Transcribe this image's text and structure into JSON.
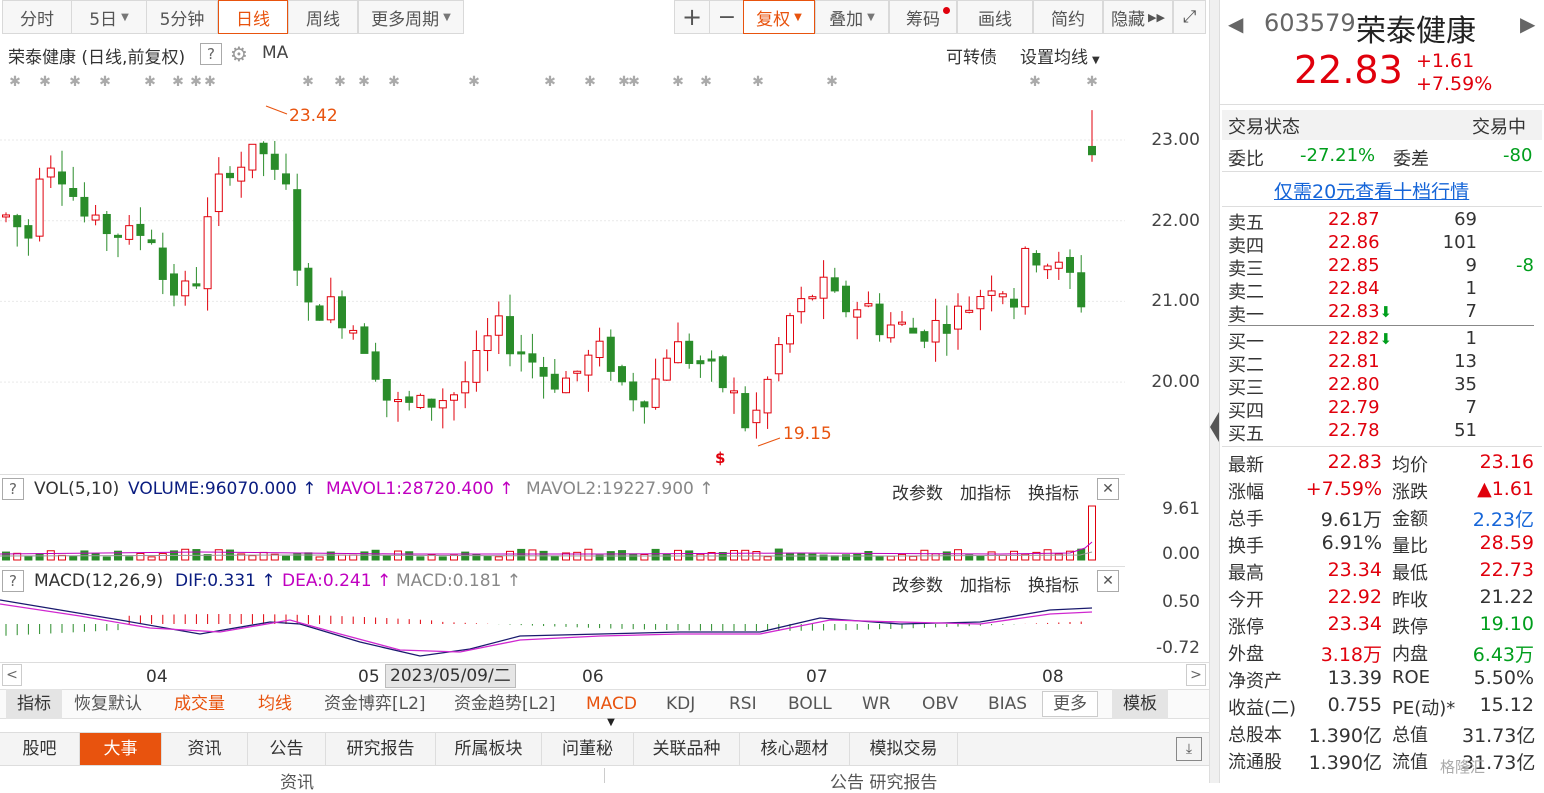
{
  "toolbar": {
    "periods": [
      "分时",
      "5日",
      "5分钟",
      "日线",
      "周线",
      "更多周期"
    ],
    "zoom_in": "+",
    "zoom_out": "−",
    "right": [
      "复权",
      "叠加",
      "筹码",
      "画线",
      "简约",
      "隐藏"
    ],
    "expand": "⤢"
  },
  "chart": {
    "title": "荣泰健康 (日线,前复权)",
    "help": "?",
    "ma": "MA",
    "convertible": "可转债",
    "set_ma": "设置均线",
    "y_labels": [
      "23.00",
      "22.00",
      "21.00",
      "20.00"
    ],
    "high_label": "23.42",
    "low_label": "19.15",
    "s_marker": "$",
    "y_ticks": [
      23,
      22,
      21,
      20
    ],
    "y_range": [
      19.15,
      23.42
    ]
  },
  "vol": {
    "help": "?",
    "name": "VOL(5,10)",
    "volume": "VOLUME:96070.000",
    "mavol1": "MAVOL1:28720.400",
    "mavol2": "MAVOL2:19227.900",
    "arrow": "↑",
    "y_top": "9.61",
    "y_bot": "0.00"
  },
  "macd": {
    "help": "?",
    "name": "MACD(12,26,9)",
    "dif": "DIF:0.331",
    "dea": "DEA:0.241",
    "macd": "MACD:0.181",
    "arrow": "↑",
    "y_top": "0.50",
    "y_bot": "-0.72"
  },
  "indicator_btns": [
    "改参数",
    "加指标",
    "换指标"
  ],
  "close_x": "✕",
  "xaxis": {
    "labels": [
      "04",
      "05",
      "06",
      "07",
      "08"
    ],
    "cursor_date": "2023/05/09/二",
    "left_arrow": "<",
    "right_arrow": ">"
  },
  "indicator_tabs": {
    "first": "指标",
    "items": [
      "恢复默认",
      "成交量",
      "均线",
      "资金博弈[L2]",
      "资金趋势[L2]",
      "MACD",
      "KDJ",
      "RSI",
      "BOLL",
      "WR",
      "OBV",
      "BIAS"
    ],
    "more": "更多",
    "template": "模板"
  },
  "bottom_tabs": [
    "股吧",
    "大事",
    "资讯",
    "公告",
    "研究报告",
    "所属板块",
    "问董秘",
    "关联品种",
    "核心题材",
    "模拟交易"
  ],
  "bottom_cut": {
    "left": "资讯",
    "right": "公告  研究报告"
  },
  "quote": {
    "code": "603579",
    "name": "荣泰健康",
    "price": "22.83",
    "change": "+1.61",
    "pct": "+7.59%",
    "status_label": "交易状态",
    "status": "交易中",
    "wb_label": "委比",
    "wb": "-27.21%",
    "wc_label": "委差",
    "wc": "-80",
    "depth_link": "仅需20元查看十档行情",
    "asks": [
      {
        "l": "卖五",
        "p": "22.87",
        "v": "69",
        "d": ""
      },
      {
        "l": "卖四",
        "p": "22.86",
        "v": "101",
        "d": ""
      },
      {
        "l": "卖三",
        "p": "22.85",
        "v": "9",
        "d": "-8"
      },
      {
        "l": "卖二",
        "p": "22.84",
        "v": "1",
        "d": ""
      },
      {
        "l": "卖一",
        "p": "22.83",
        "v": "7",
        "d": ""
      }
    ],
    "bids": [
      {
        "l": "买一",
        "p": "22.82",
        "v": "1"
      },
      {
        "l": "买二",
        "p": "22.81",
        "v": "13"
      },
      {
        "l": "买三",
        "p": "22.80",
        "v": "35"
      },
      {
        "l": "买四",
        "p": "22.79",
        "v": "7"
      },
      {
        "l": "买五",
        "p": "22.78",
        "v": "51"
      }
    ],
    "down_arrow": "⬇",
    "stats": [
      [
        "最新",
        "22.83",
        "均价",
        "23.16"
      ],
      [
        "涨幅",
        "+7.59%",
        "涨跌",
        "▲1.61"
      ],
      [
        "总手",
        "9.61万",
        "金额",
        "2.23亿"
      ],
      [
        "换手",
        "6.91%",
        "量比",
        "28.59"
      ],
      [
        "最高",
        "23.34",
        "最低",
        "22.73"
      ],
      [
        "今开",
        "22.92",
        "昨收",
        "21.22"
      ],
      [
        "涨停",
        "23.34",
        "跌停",
        "19.10"
      ],
      [
        "外盘",
        "3.18万",
        "内盘",
        "6.43万"
      ],
      [
        "净资产",
        "13.39",
        "ROE",
        "5.50%"
      ],
      [
        "收益(二)",
        "0.755",
        "PE(动)*",
        "15.12"
      ],
      [
        "总股本",
        "1.390亿",
        "总值",
        "31.73亿"
      ],
      [
        "流通股",
        "1.390亿",
        "流值",
        "31.73亿"
      ]
    ],
    "nav_prev": "◀",
    "nav_next": "▶"
  },
  "colors": {
    "up": "#e0000c",
    "down": "#009e1c",
    "candle_down": "#2a8c2a",
    "accent": "#e8530e",
    "mavol1": "#c000c0",
    "dif": "#1a1a6e",
    "dea": "#d028d0"
  }
}
